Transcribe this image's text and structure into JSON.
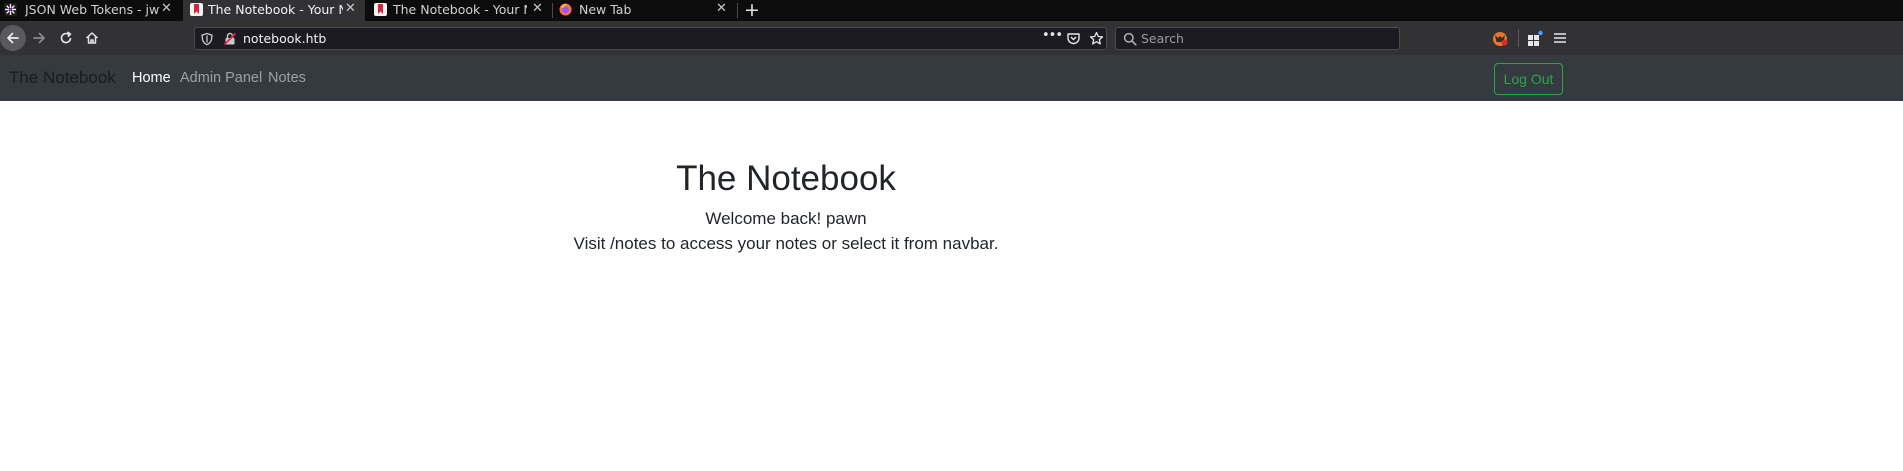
{
  "browser": {
    "tabs": [
      {
        "title": "JSON Web Tokens - jwt.io",
        "favicon": "jwt-logo-icon",
        "active": false
      },
      {
        "title": "The Notebook - Your Notes",
        "favicon": "bookmark-page-icon",
        "active": true
      },
      {
        "title": "The Notebook - Your Notes",
        "favicon": "bookmark-page-icon",
        "active": false
      },
      {
        "title": "New Tab",
        "favicon": "firefox-icon",
        "active": false
      }
    ],
    "url": "notebook.htb",
    "search_placeholder": "Search",
    "colors": {
      "tabstrip": "#0c0c0d",
      "toolbar": "#323234",
      "urlbar": "#1c1b22"
    }
  },
  "site": {
    "brand": "The Notebook",
    "nav": [
      {
        "label": "Home",
        "active": true
      },
      {
        "label": "Admin Panel",
        "active": false
      },
      {
        "label": "Notes",
        "active": false
      }
    ],
    "logout_label": "Log Out",
    "colors": {
      "navbar": "#343a40",
      "logout": "#28a745",
      "text": "#212529"
    }
  },
  "main": {
    "title": "The Notebook",
    "welcome": "Welcome back! pawn",
    "hint": "Visit /notes to access your notes or select it from navbar."
  }
}
